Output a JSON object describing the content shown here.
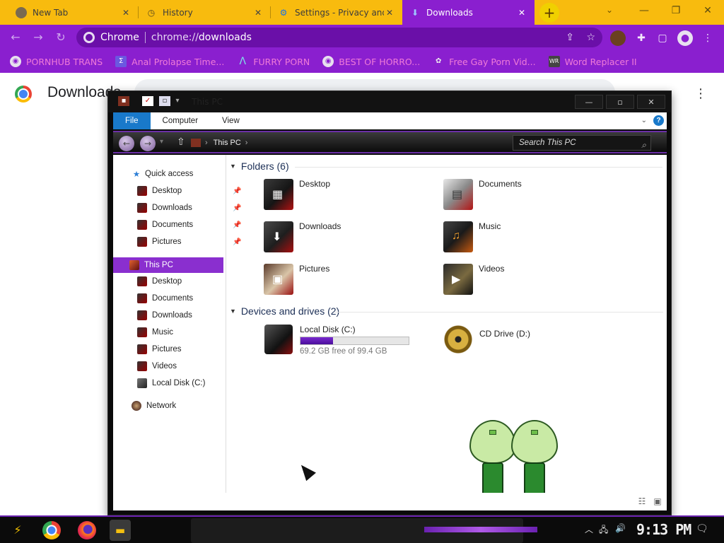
{
  "browser": {
    "tabs": [
      {
        "title": "New Tab",
        "icon": "chrome-icon"
      },
      {
        "title": "History",
        "icon": "history-icon"
      },
      {
        "title": "Settings - Privacy and",
        "icon": "gear-icon"
      },
      {
        "title": "Downloads",
        "icon": "download-icon",
        "active": true
      }
    ],
    "omnibox": {
      "chip": "Chrome",
      "url_scheme": "chrome://",
      "url_path": "downloads"
    },
    "bookmarks": [
      {
        "label": "PORNHUB TRANS"
      },
      {
        "label": "Anal Prolapse Time..."
      },
      {
        "label": "FURRY PORN"
      },
      {
        "label": "BEST OF HORRO..."
      },
      {
        "label": "Free Gay Porn Vid..."
      },
      {
        "label": "Word Replacer II"
      }
    ],
    "colors": {
      "tabstrip": "#f8bb0e",
      "toolbar": "#8a1fcf",
      "bookmark_text": "#f07ad8"
    }
  },
  "downloads_page": {
    "title": "Downloads"
  },
  "explorer": {
    "title": "This PC",
    "ribbon": {
      "file": "File",
      "computer": "Computer",
      "view": "View"
    },
    "address": {
      "location": "This PC"
    },
    "search": {
      "placeholder": "Search This PC"
    },
    "nav": {
      "quick_access": "Quick access",
      "quick_items": [
        "Desktop",
        "Downloads",
        "Documents",
        "Pictures"
      ],
      "this_pc": "This PC",
      "pc_items": [
        "Desktop",
        "Documents",
        "Downloads",
        "Music",
        "Pictures",
        "Videos",
        "Local Disk (C:)"
      ],
      "network": "Network"
    },
    "folders_header": "Folders (6)",
    "folders": [
      "Desktop",
      "Documents",
      "Downloads",
      "Music",
      "Pictures",
      "Videos"
    ],
    "drives_header": "Devices and drives (2)",
    "drives": [
      {
        "name": "Local Disk (C:)",
        "free": "69.2 GB free of 99.4 GB",
        "used_fraction": 0.3
      },
      {
        "name": "CD Drive (D:)"
      }
    ]
  },
  "taskbar": {
    "clock": "9:13 PM"
  }
}
